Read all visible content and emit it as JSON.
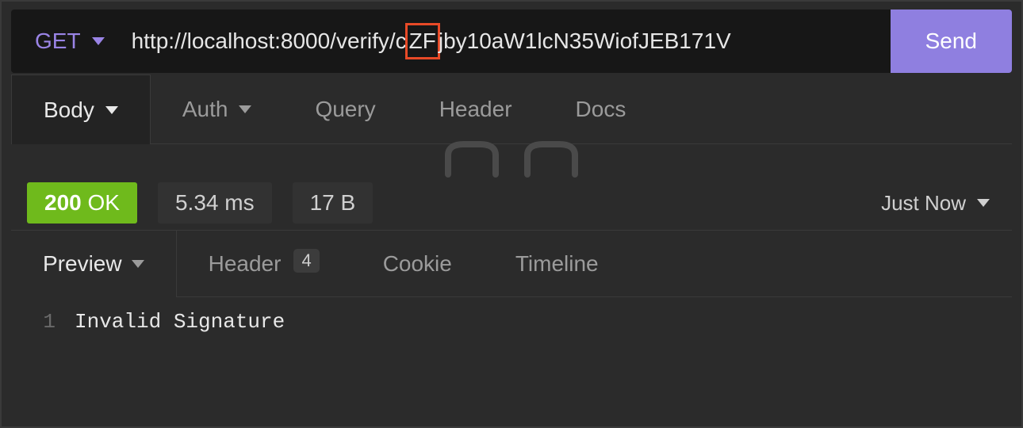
{
  "request": {
    "method": "GET",
    "url_pre": "http://localhost:8000/verify/c",
    "url_highlight": "ZF",
    "url_post": "jby10aW1lcN35WiofJEB171V",
    "send_label": "Send"
  },
  "request_tabs": {
    "body": "Body",
    "auth": "Auth",
    "query": "Query",
    "header": "Header",
    "docs": "Docs"
  },
  "status": {
    "code": "200",
    "text": "OK",
    "time": "5.34 ms",
    "size": "17 B",
    "when": "Just Now"
  },
  "response_tabs": {
    "preview": "Preview",
    "header": "Header",
    "header_count": "4",
    "cookie": "Cookie",
    "timeline": "Timeline"
  },
  "response_body": {
    "line_no": "1",
    "text": "Invalid Signature"
  }
}
